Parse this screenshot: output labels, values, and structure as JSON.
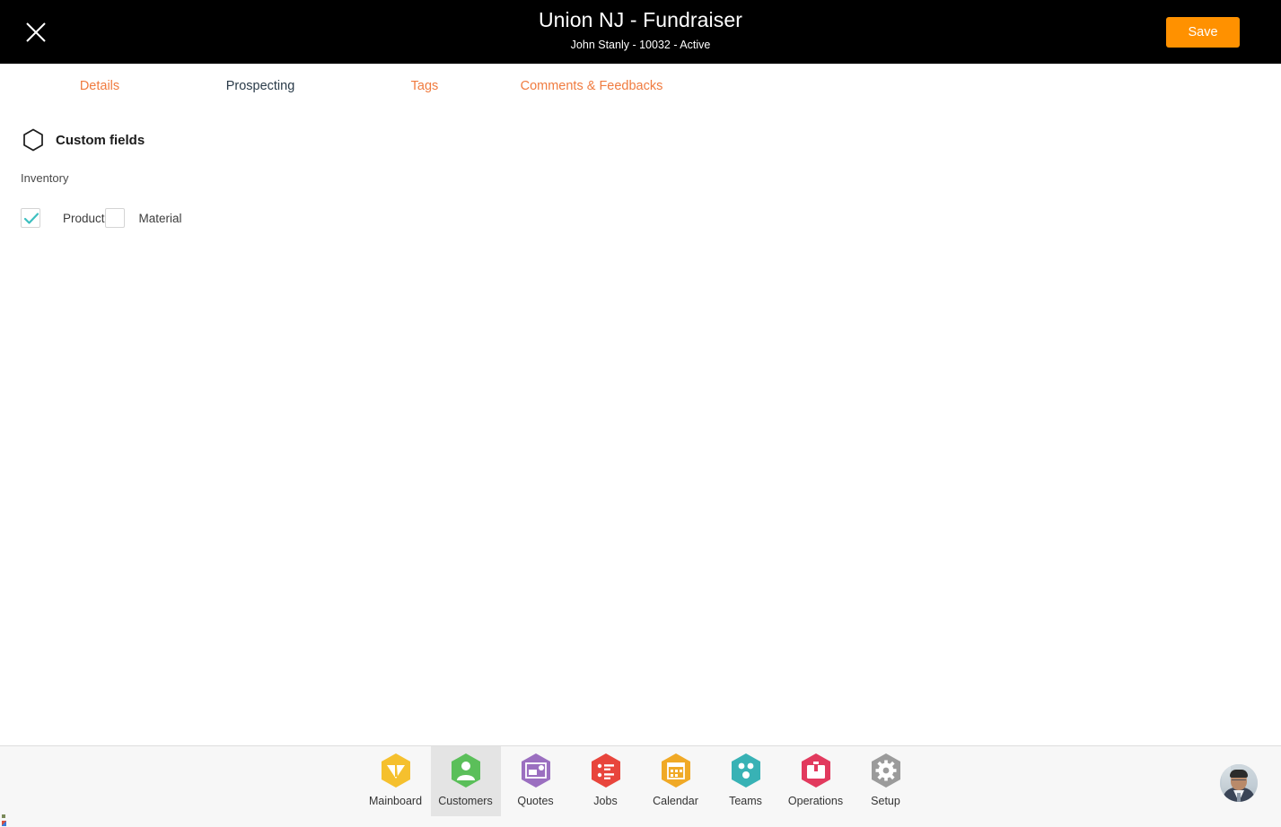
{
  "header": {
    "title": "Union NJ - Fundraiser",
    "subtitle": "John Stanly - 10032 - Active",
    "close_icon": "close-icon",
    "save_label": "Save",
    "accent_color": "#FF9100",
    "background_color": "#000000"
  },
  "tabs": {
    "items": [
      {
        "label": "Details",
        "state": "inactive",
        "color": "#F07B3F"
      },
      {
        "label": "Prospecting",
        "state": "active",
        "color": "#2a3b49"
      },
      {
        "label": "Tags",
        "state": "inactive",
        "color": "#F07B3F",
        "highlighted": true
      },
      {
        "label": "Comments & Feedbacks",
        "state": "inactive",
        "color": "#F07B3F"
      }
    ],
    "highlight_color": "#F4663B",
    "rule_color": "#22303c"
  },
  "content": {
    "section": {
      "icon": "hexagon-icon",
      "title": "Custom fields"
    },
    "group_label": "Inventory",
    "checkboxes": [
      {
        "label": "Product",
        "checked": true,
        "check_color": "#3dbfc0"
      },
      {
        "label": "Material",
        "checked": false
      }
    ]
  },
  "bottom_nav": {
    "items": [
      {
        "label": "Mainboard",
        "icon": "dashboard-icon",
        "color": "#F5C02E",
        "active": false
      },
      {
        "label": "Customers",
        "icon": "person-icon",
        "color": "#5BBF5A",
        "active": true
      },
      {
        "label": "Quotes",
        "icon": "invoice-icon",
        "color": "#9B6FC0",
        "active": false
      },
      {
        "label": "Jobs",
        "icon": "list-icon",
        "color": "#E8453C",
        "active": false
      },
      {
        "label": "Calendar",
        "icon": "calendar-icon",
        "color": "#F0A926",
        "active": false
      },
      {
        "label": "Teams",
        "icon": "team-icon",
        "color": "#38B2B5",
        "active": false
      },
      {
        "label": "Operations",
        "icon": "briefcase-icon",
        "color": "#E23A5E",
        "active": false
      },
      {
        "label": "Setup",
        "icon": "gear-icon",
        "color": "#9B9B9B",
        "active": false
      }
    ],
    "avatar": "user-avatar",
    "background_color": "#f7f7f7",
    "active_background_color": "#e4e4e4"
  }
}
